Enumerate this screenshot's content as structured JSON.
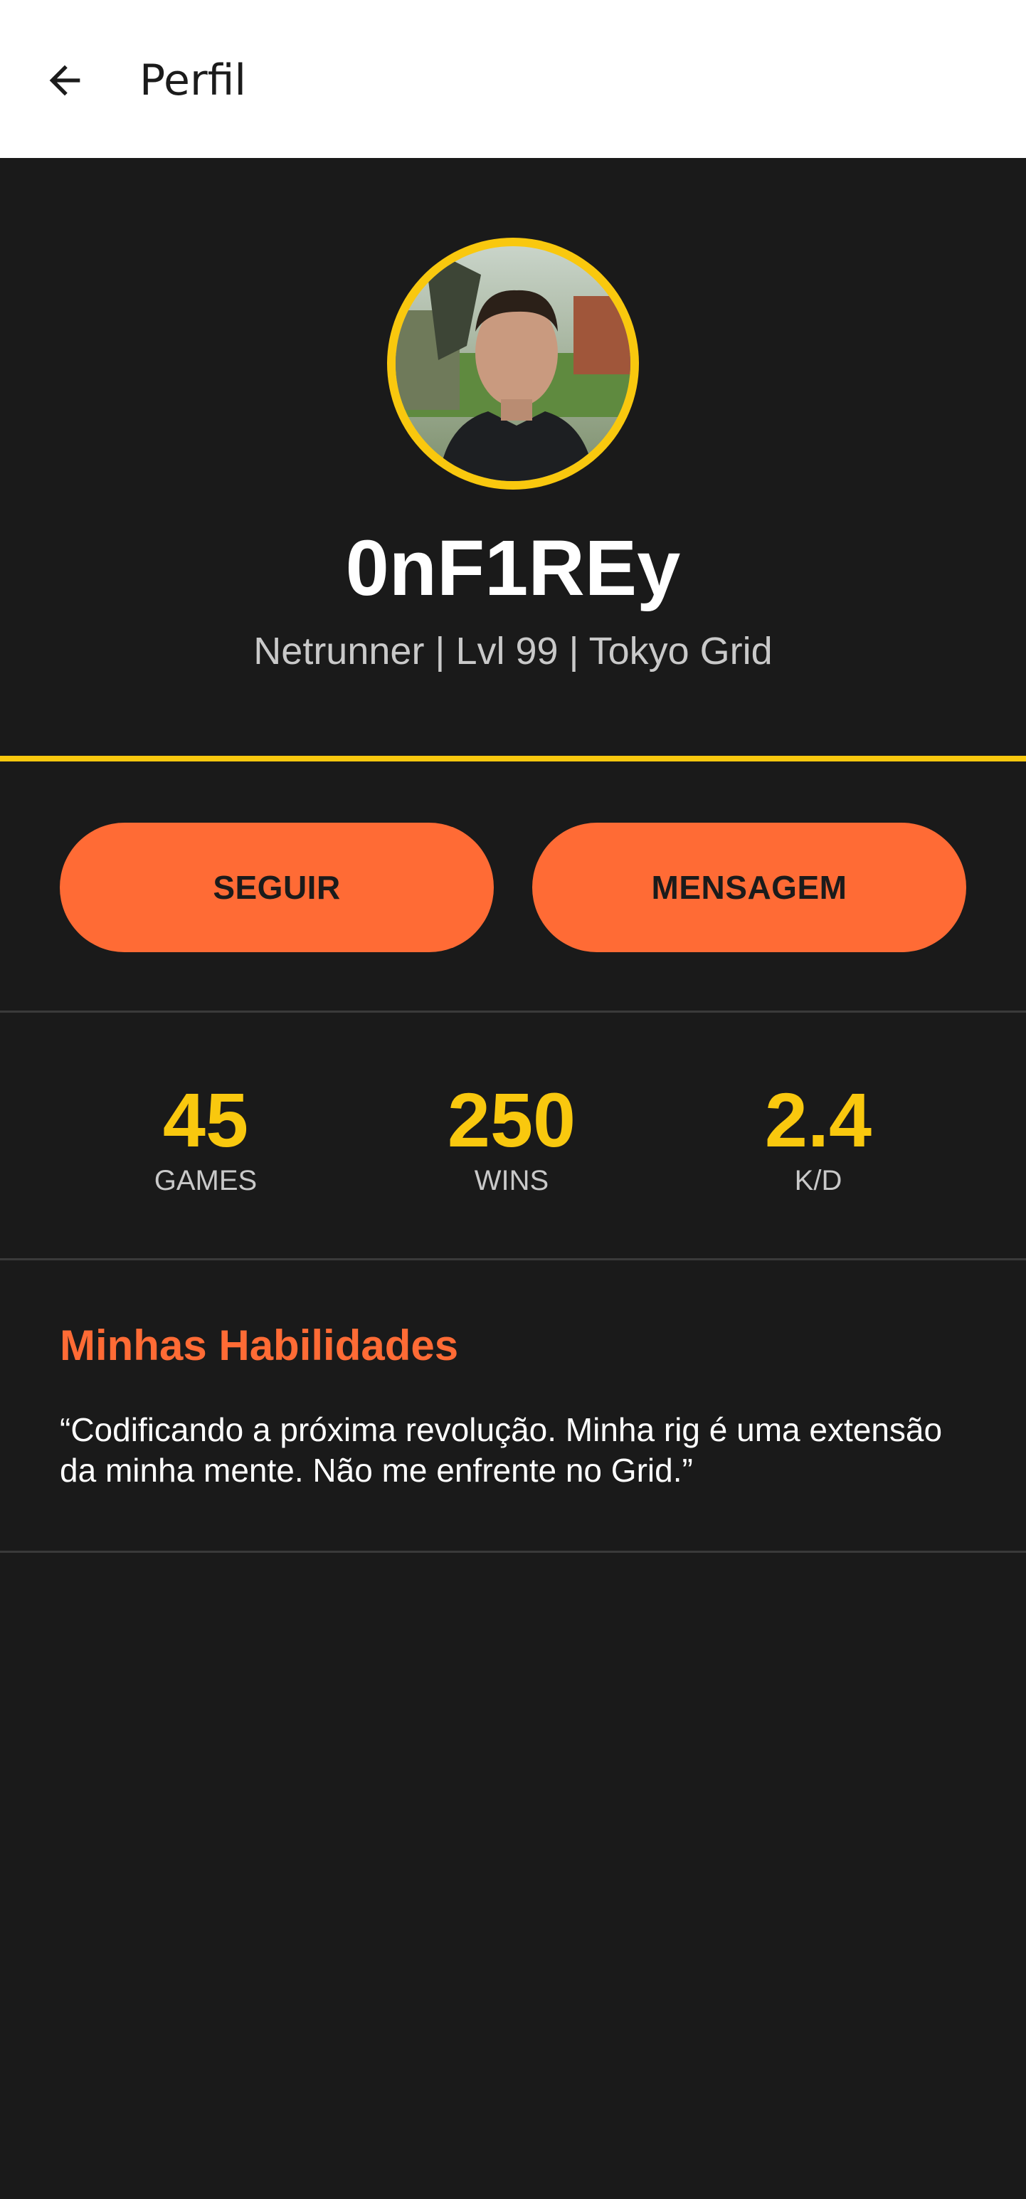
{
  "appbar": {
    "title": "Perfil",
    "back_icon": "arrow-left-icon"
  },
  "profile": {
    "username": "0nF1REy",
    "subtitle": "Netrunner | Lvl 99 | Tokyo Grid",
    "avatar_alt": "avatar"
  },
  "actions": {
    "follow_label": "SEGUIR",
    "message_label": "MENSAGEM"
  },
  "stats": [
    {
      "value": "45",
      "label": "GAMES"
    },
    {
      "value": "250",
      "label": "WINS"
    },
    {
      "value": "2.4",
      "label": "K/D"
    }
  ],
  "about": {
    "title": "Minhas Habilidades",
    "text": "“Codificando a próxima revolução. Minha rig é uma extensão da minha mente. Não me enfrente no Grid.”"
  },
  "colors": {
    "background": "#1a1a1a",
    "accent_yellow": "#f9c80e",
    "accent_orange": "#ff6b35",
    "appbar": "#ffffff"
  }
}
